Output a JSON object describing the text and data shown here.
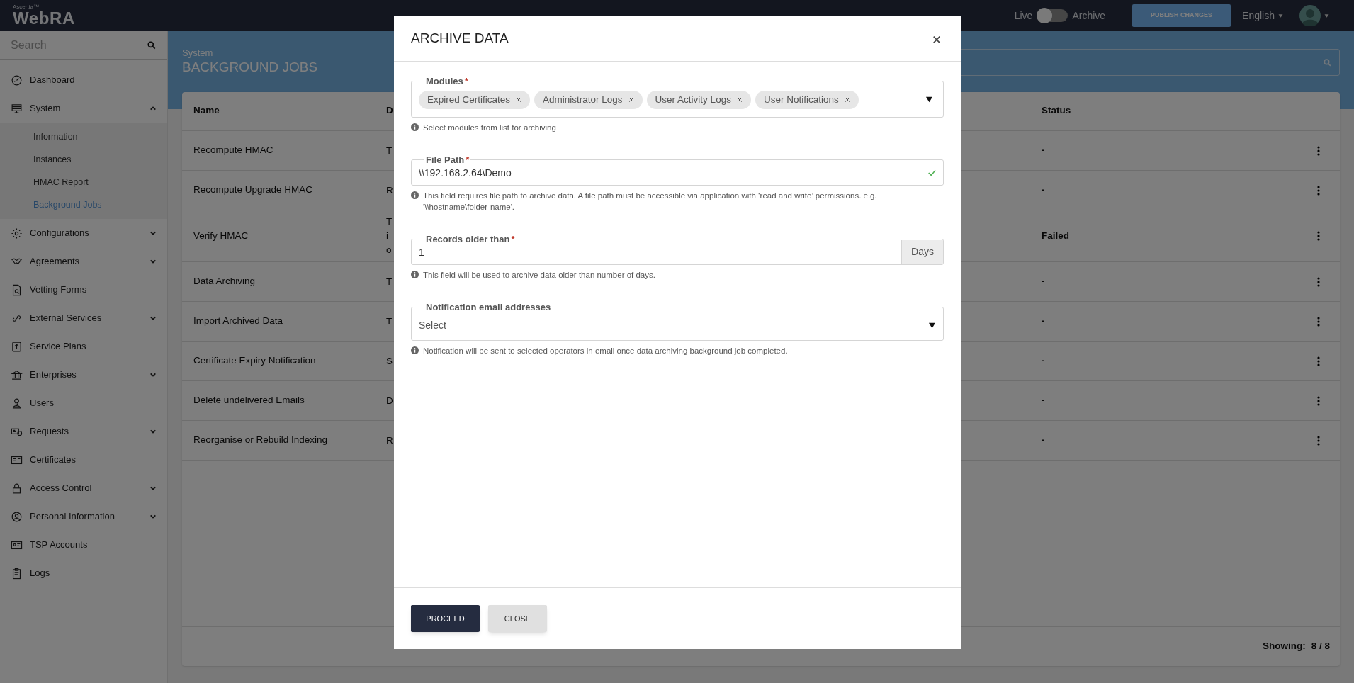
{
  "brand": {
    "maker": "Ascertia™",
    "product": "WebRA"
  },
  "topbar": {
    "live_label": "Live",
    "archive_label": "Archive",
    "archive_mode": false,
    "publish_button": "PUBLISH CHANGES",
    "language": "English"
  },
  "sidebar": {
    "search_placeholder": "Search",
    "items": [
      {
        "label": "Dashboard"
      },
      {
        "label": "System",
        "expanded": true,
        "children": [
          {
            "label": "Information",
            "selected": false
          },
          {
            "label": "Instances",
            "selected": false
          },
          {
            "label": "HMAC Report",
            "selected": false
          },
          {
            "label": "Background Jobs",
            "selected": true
          }
        ]
      },
      {
        "label": "Configurations",
        "expanded": false
      },
      {
        "label": "Agreements",
        "expanded": false
      },
      {
        "label": "Vetting Forms"
      },
      {
        "label": "External Services",
        "expanded": false
      },
      {
        "label": "Service Plans"
      },
      {
        "label": "Enterprises",
        "expanded": false
      },
      {
        "label": "Users"
      },
      {
        "label": "Requests",
        "expanded": false
      },
      {
        "label": "Certificates"
      },
      {
        "label": "Access Control",
        "expanded": false
      },
      {
        "label": "Personal Information",
        "expanded": false
      },
      {
        "label": "TSP Accounts"
      },
      {
        "label": "Logs"
      }
    ]
  },
  "page": {
    "breadcrumb": "System",
    "title": "BACKGROUND JOBS"
  },
  "table": {
    "columns": [
      "Name",
      "D",
      "Status"
    ],
    "rows": [
      {
        "name": "Recompute HMAC",
        "column_2": [
          "T"
        ],
        "status": "-"
      },
      {
        "name": "Recompute Upgrade HMAC",
        "column_2": [
          "R"
        ],
        "status": "-"
      },
      {
        "name": "Verify HMAC",
        "column_2": [
          "T",
          "i",
          "o"
        ],
        "status": "Failed"
      },
      {
        "name": "Data Archiving",
        "column_2": [
          "T"
        ],
        "status": "-"
      },
      {
        "name": "Import Archived Data",
        "column_2": [
          "T"
        ],
        "status": "-"
      },
      {
        "name": "Certificate Expiry Notification",
        "column_2": [
          "S"
        ],
        "status": "-"
      },
      {
        "name": "Delete undelivered Emails",
        "column_2": [
          "D"
        ],
        "status": "-"
      },
      {
        "name": "Reorganise or Rebuild Indexing",
        "column_2": [
          "R"
        ],
        "status": "-"
      }
    ],
    "footer_label": "Showing:",
    "footer_count": "8 / 8"
  },
  "modal": {
    "title": "ARCHIVE DATA",
    "required_mark": "*",
    "fields": [
      {
        "kind": "tags",
        "label": "Modules",
        "required": true,
        "tags": [
          "Expired Certificates",
          "Administrator Logs",
          "User Activity Logs",
          "User Notifications"
        ],
        "help": "Select modules from list for archiving"
      },
      {
        "kind": "text",
        "label": "File Path",
        "required": true,
        "value": "\\\\192.168.2.64\\Demo",
        "valid": true,
        "help": "This field requires file path to archive data. A file path must be accessible via application with ‘read and write’ permissions. e.g. '\\\\hostname\\folder-name'."
      },
      {
        "kind": "addon",
        "label": "Records older than",
        "required": true,
        "value": "1",
        "addon": "Days",
        "help": "This field will be used to archive data older than number of days."
      },
      {
        "kind": "select",
        "label": "Notification email addresses",
        "required": false,
        "placeholder": "Select",
        "help": "Notification will be sent to selected operators in email once data archiving background job completed."
      }
    ],
    "buttons": [
      {
        "label": "PROCEED",
        "kind": "primary"
      },
      {
        "label": "CLOSE",
        "kind": "secondary"
      }
    ]
  }
}
